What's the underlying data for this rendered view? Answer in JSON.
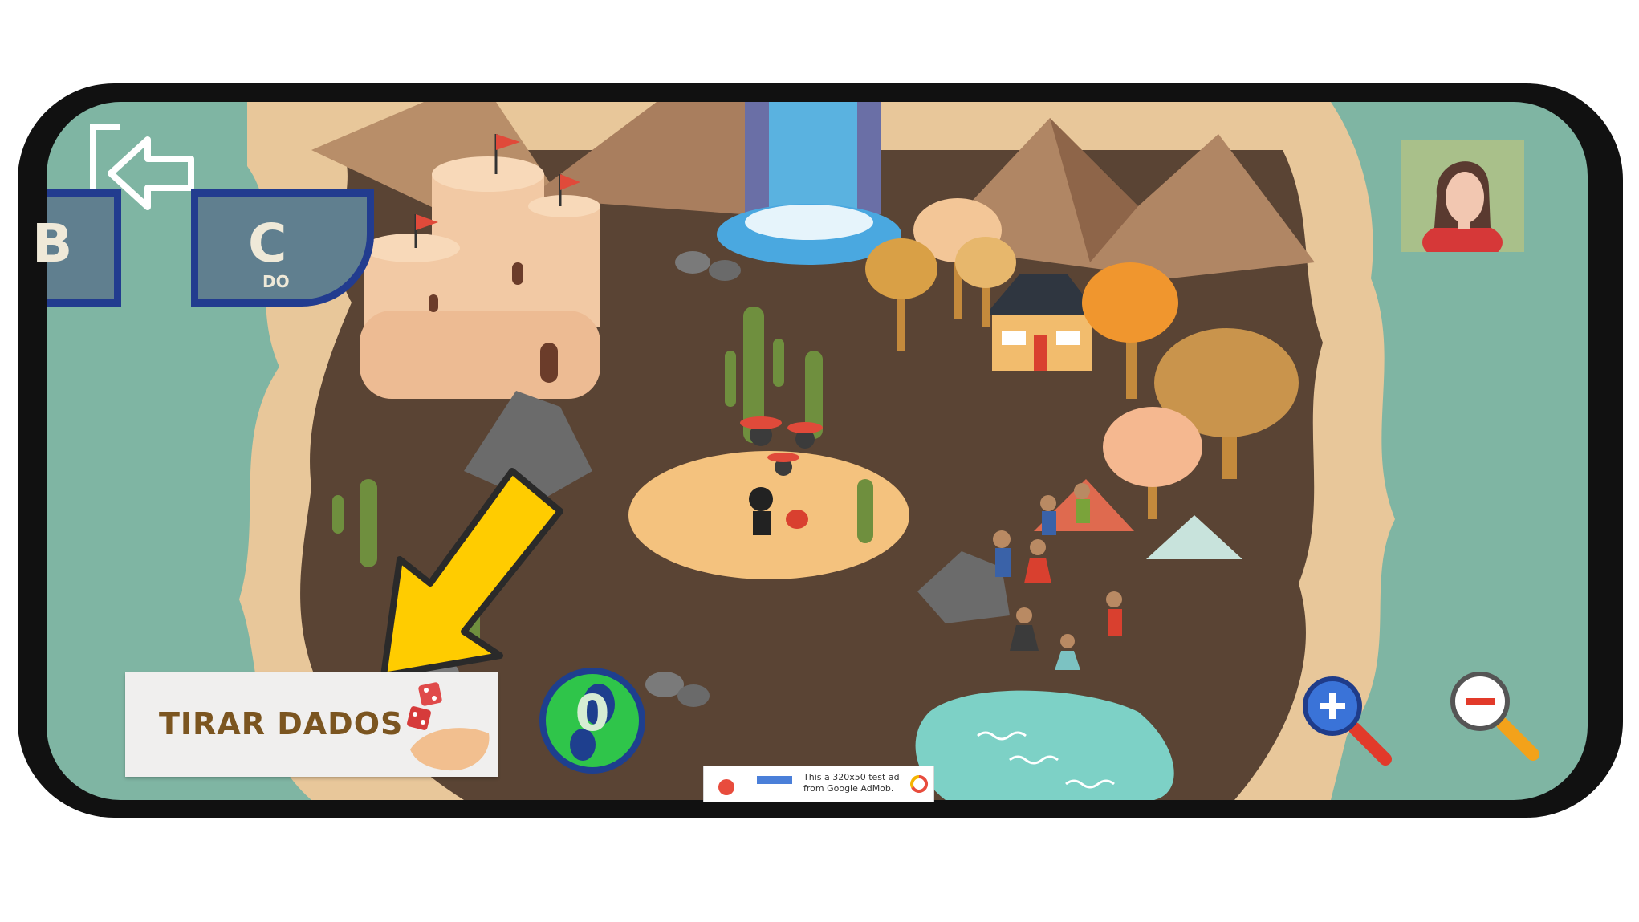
{
  "colors": {
    "water": "#7fb5a3",
    "sand": "#e8c79a",
    "dirt": "#5a4434",
    "tile_fill": "#607f8f",
    "tile_border": "#223c8f",
    "steps_green": "#2fc54a",
    "button_text": "#7b5520"
  },
  "tiles": {
    "current": {
      "letter": "C",
      "note": "DO"
    },
    "previous": {
      "letter": "B"
    }
  },
  "actions": {
    "roll_dice_label": "TIRAR DADOS",
    "steps_count": "0"
  },
  "icons": {
    "back": "exit-arrow-icon",
    "avatar": "user-avatar-icon",
    "zoom_in": "zoom-in-icon",
    "zoom_out": "zoom-out-icon",
    "dice": "dice-hand-icon",
    "footprint": "footprint-icon"
  },
  "ad": {
    "text": "This a 320x50 test ad from Google AdMob."
  }
}
